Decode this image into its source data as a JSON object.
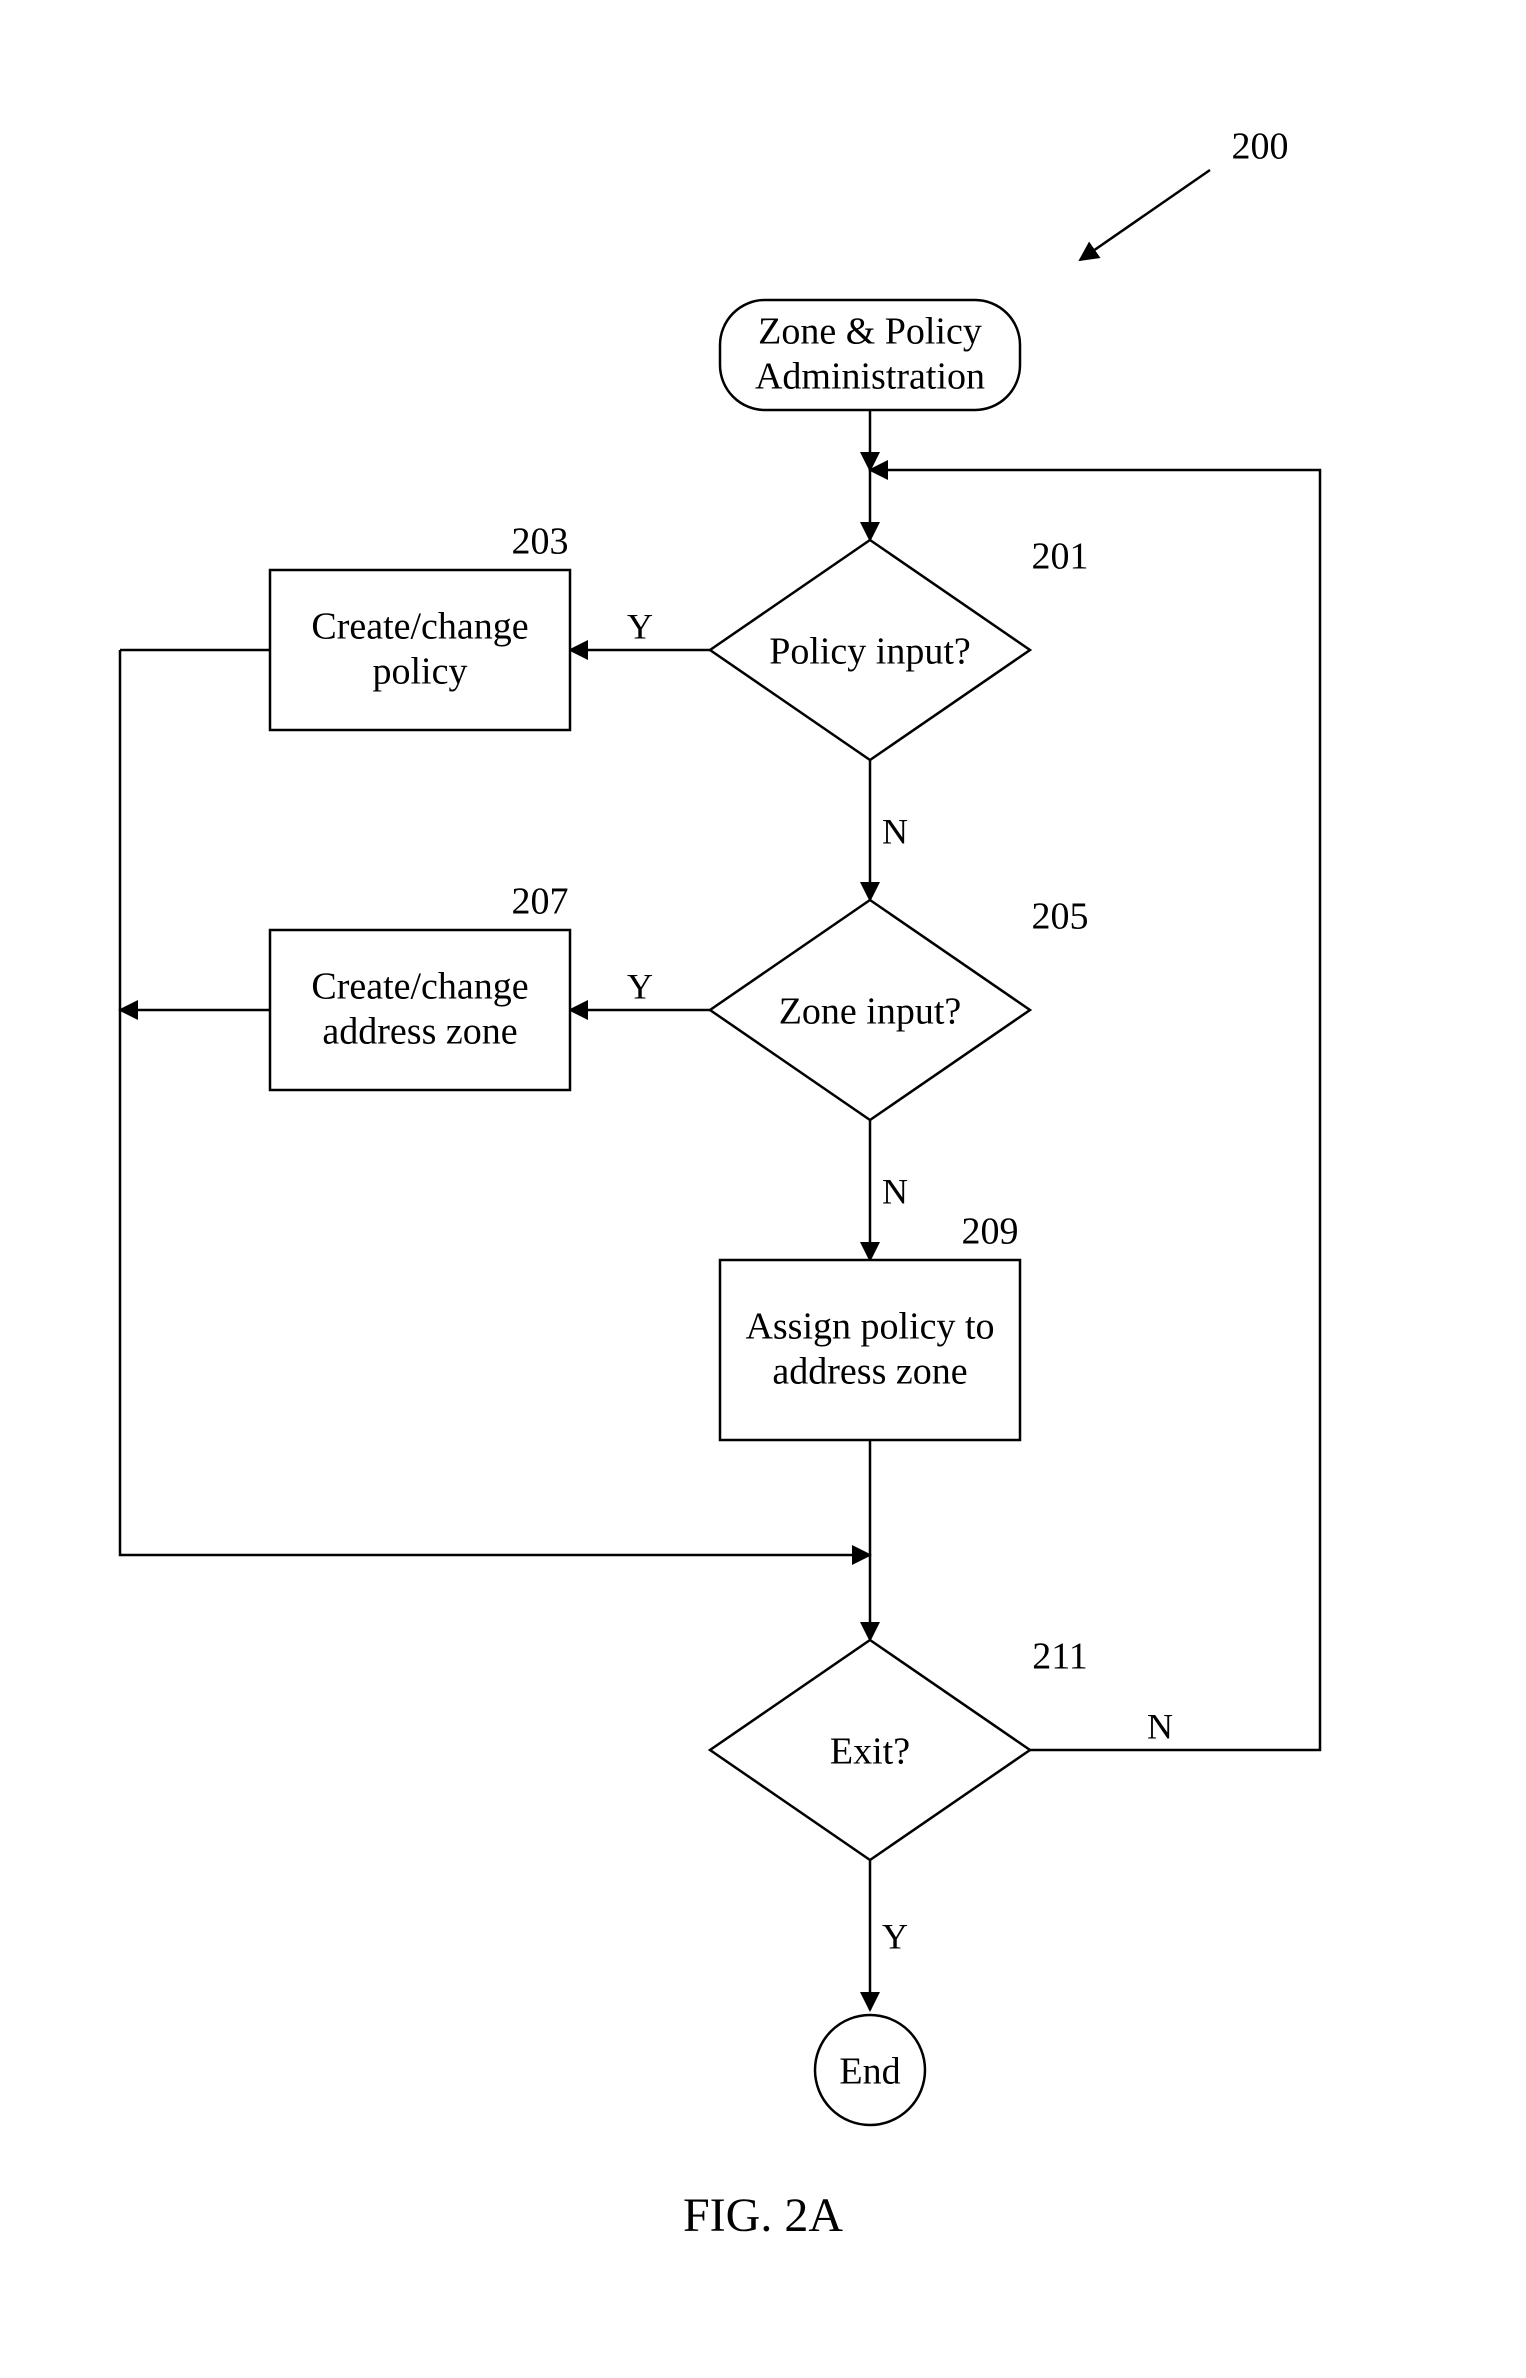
{
  "figure_label": "FIG. 2A",
  "figure_ref": "200",
  "nodes": {
    "start": {
      "ref": "",
      "text_lines": [
        "Zone & Policy",
        "Administration"
      ]
    },
    "d201": {
      "ref": "201",
      "text_lines": [
        "Policy input?"
      ]
    },
    "p203": {
      "ref": "203",
      "text_lines": [
        "Create/change",
        "policy"
      ]
    },
    "d205": {
      "ref": "205",
      "text_lines": [
        "Zone input?"
      ]
    },
    "p207": {
      "ref": "207",
      "text_lines": [
        "Create/change",
        "address zone"
      ]
    },
    "p209": {
      "ref": "209",
      "text_lines": [
        "Assign policy to",
        "address zone"
      ]
    },
    "d211": {
      "ref": "211",
      "text_lines": [
        "Exit?"
      ]
    },
    "end": {
      "ref": "",
      "text_lines": [
        "End"
      ]
    }
  },
  "edge_labels": {
    "d201_yes": "Y",
    "d201_no": "N",
    "d205_yes": "Y",
    "d205_no": "N",
    "d211_yes": "Y",
    "d211_no": "N"
  }
}
